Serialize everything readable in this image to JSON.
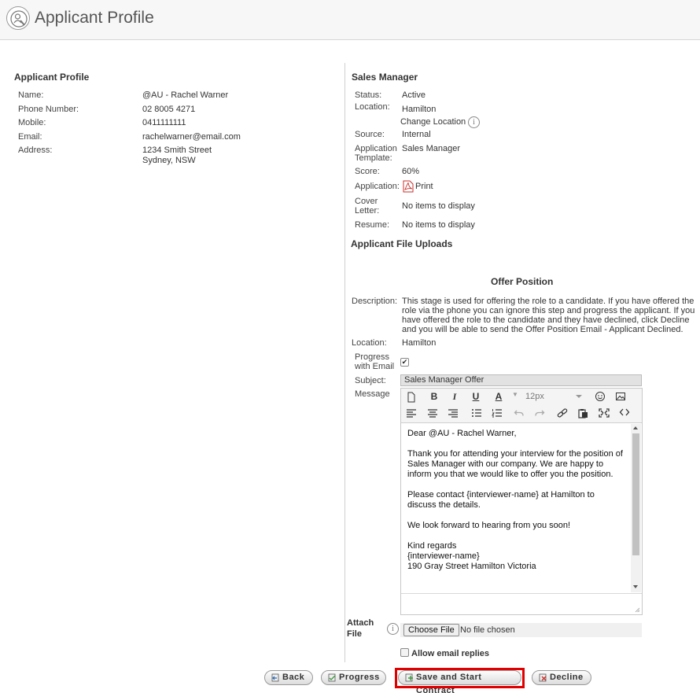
{
  "header": {
    "title": "Applicant Profile",
    "logo_icon": "applicant-search-icon"
  },
  "applicant": {
    "heading": "Applicant Profile",
    "fields": [
      {
        "label": "Name:",
        "value": "@AU - Rachel Warner"
      },
      {
        "label": "Phone Number:",
        "value": "02 8005 4271"
      },
      {
        "label": "Mobile:",
        "value": "0411111111"
      },
      {
        "label": "Email:",
        "value": "rachelwarner@email.com"
      },
      {
        "label": "Address:",
        "value": "1234 Smith Street",
        "value2": "Sydney, NSW"
      }
    ]
  },
  "job": {
    "heading": "Sales Manager",
    "status_label": "Status:",
    "status": "Active",
    "location_label": "Location:",
    "location": "Hamilton",
    "change_location": "Change Location",
    "source_label": "Source:",
    "source": "Internal",
    "template_label_1": "Application",
    "template_label_2": "Template:",
    "template": "Sales Manager",
    "score_label": "Score:",
    "score": "60%",
    "application_label": "Application:",
    "print_label": "Print",
    "cover_label_1": "Cover",
    "cover_label_2": "Letter:",
    "cover_value": "No items to display",
    "resume_label": "Resume:",
    "resume_value": "No items to display",
    "uploads_heading": "Applicant File Uploads"
  },
  "offer": {
    "heading": "Offer Position",
    "description_label": "Description:",
    "description": "This stage is used for offering the role to a candidate. If you have offered the role via the phone you can ignore this step and progress the applicant. If you have offered the role to the candidate and they have declined, click Decline and you will be able to send the Offer Position Email - Applicant Declined.",
    "location_label": "Location:",
    "location": "Hamilton",
    "progress_label_1": "Progress",
    "progress_label_2": "with Email",
    "progress_checked": true,
    "subject_label": "Subject:",
    "subject": "Sales Manager Offer",
    "message_label": "Message",
    "font_size": "12px",
    "message": [
      "Dear @AU - Rachel Warner,",
      "Thank you for attending your interview for the position of Sales Manager with our company. We are happy to inform you that we would like to offer you the position.",
      "Please contact {interviewer-name} at Hamilton to discuss the details.",
      "We look forward to hearing from you soon!",
      "Kind regards\n{interviewer-name}\n190 Gray Street Hamilton Victoria"
    ],
    "attach_label_1": "Attach",
    "attach_label_2": "File",
    "choose_file": "Choose File",
    "no_file": "No file chosen",
    "allow_replies": "Allow email replies",
    "allow_replies_checked": false
  },
  "actions": {
    "back": "Back",
    "progress": "Progress",
    "save_contract": "Save and Start Contract",
    "decline": "Decline",
    "highlight_color": "#e00000"
  }
}
